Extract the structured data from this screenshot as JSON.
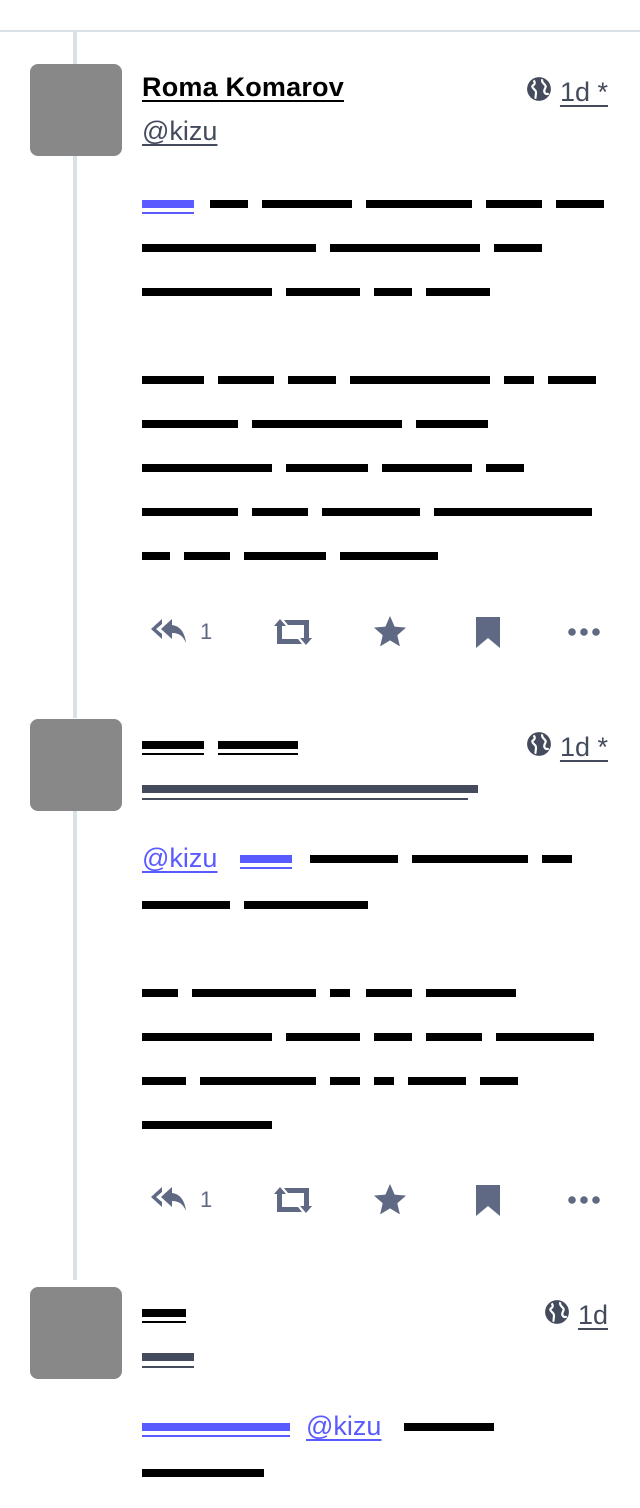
{
  "statuses": [
    {
      "display_name": "Roma Komarov",
      "handle": "@kizu",
      "visibility_icon": "globe-icon",
      "time": "1d *",
      "reply_count": "1"
    },
    {
      "display_name": "",
      "handle": "",
      "visibility_icon": "globe-icon",
      "time": "1d *",
      "mention": "@kizu",
      "reply_count": "1"
    },
    {
      "display_name": "",
      "handle": "",
      "visibility_icon": "globe-icon",
      "time": "1d",
      "mention": "@kizu"
    }
  ],
  "icons": {
    "reply": "reply-all-icon",
    "boost": "retweet-icon",
    "favourite": "star-icon",
    "bookmark": "bookmark-icon",
    "more": "ellipsis-icon"
  },
  "colors": {
    "text": "#000000",
    "secondary": "#444b5d",
    "action": "#606984",
    "link": "#595aff",
    "thread_line": "#d9e1e8",
    "avatar": "#888888"
  }
}
